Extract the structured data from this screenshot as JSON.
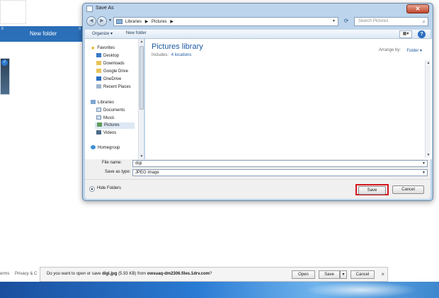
{
  "background": {
    "tile_count_1": "0",
    "tile_count_2": "0",
    "new_folder_label": "New folder",
    "footer_links": [
      "erms",
      "Privacy & C"
    ]
  },
  "dialog": {
    "title": "Save As",
    "close_glyph": "✕",
    "address": {
      "crumbs": [
        "Libraries",
        "▶",
        "Pictures",
        "▶"
      ],
      "separator": "▶"
    },
    "search_placeholder": "Search Pictures",
    "toolbar": {
      "organize": "Organize ▾",
      "new_folder": "New folder",
      "help": "?"
    },
    "nav": {
      "favorites": "Favorites",
      "desktop": "Desktop",
      "downloads": "Downloads",
      "google_drive": "Google Drive",
      "onedrive": "OneDrive",
      "recent_places": "Recent Places",
      "libraries": "Libraries",
      "documents": "Documents",
      "music": "Music",
      "pictures": "Pictures",
      "videos": "Videos",
      "homegroup": "Homegroup"
    },
    "content": {
      "library_title": "Pictures library",
      "includes_label": "Includes:",
      "locations_link": "4 locations",
      "arrange_by_label": "Arrange by:",
      "arrange_by_value": "Folder ▾"
    },
    "fields": {
      "file_name_label": "File name:",
      "file_name_value": "digi",
      "save_as_type_label": "Save as type:",
      "save_as_type_value": "JPEG image"
    },
    "bottom": {
      "hide_folders": "Hide Folders",
      "save": "Save",
      "cancel": "Cancel"
    }
  },
  "download_bar": {
    "prefix": "Do you want to open or save",
    "file_name": "digi.jpg",
    "size": "(5.93 KB)",
    "from": "from",
    "host": "owsuaq-dm2306.files.1drv.com",
    "suffix": "?",
    "open": "Open",
    "save": "Save",
    "save_drop": "▾",
    "cancel": "Cancel",
    "close": "×"
  },
  "colors": {
    "accent_blue": "#2a6fb8",
    "link_blue": "#1e5aa1",
    "highlight_red": "#d4161e",
    "dialog_frame": "#bcd4ec"
  }
}
